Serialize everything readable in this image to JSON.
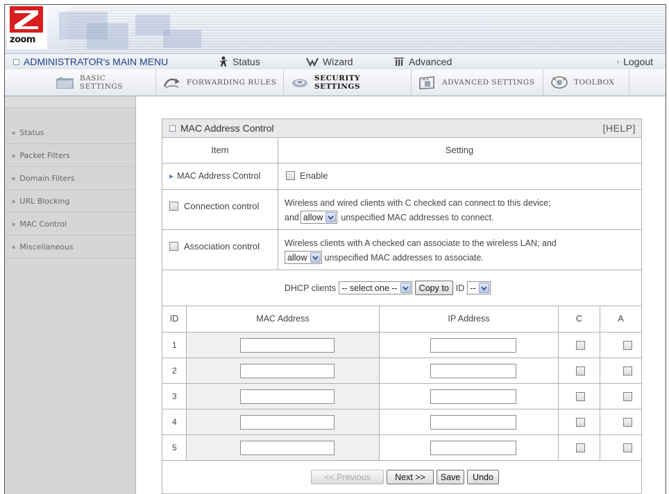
{
  "brand": {
    "logo_text": "zoom",
    "accent": "#d81e1e"
  },
  "topnav": {
    "admin": "ADMINISTRATOR's MAIN MENU",
    "status": "Status",
    "wizard": "Wizard",
    "advanced": "Advanced",
    "logout": "Logout"
  },
  "tabs": [
    {
      "label": "BASIC SETTINGS",
      "icon": "folder-icon"
    },
    {
      "label": "FORWARDING RULES",
      "icon": "arrows-icon"
    },
    {
      "label": "SECURITY SETTINGS",
      "icon": "shield-disc-icon"
    },
    {
      "label": "ADVANCED SETTINGS",
      "icon": "gear-box-icon"
    },
    {
      "label": "TOOLBOX",
      "icon": "toolbox-icon"
    }
  ],
  "sidebar": {
    "items": [
      "Status",
      "Packet Filters",
      "Domain Filters",
      "URL Blocking",
      "MAC Control",
      "Miscellaneous"
    ]
  },
  "panel": {
    "title": "MAC Address Control",
    "help": "[HELP]",
    "col_item": "Item",
    "col_setting": "Setting",
    "mac_control_label": "MAC Address Control",
    "enable_label": "Enable",
    "connection": {
      "label": "Connection control",
      "line1": "Wireless and wired clients with C checked can connect to this device;",
      "line2_pre": "and",
      "select": "allow",
      "line2_post": "unspecified MAC addresses to connect."
    },
    "association": {
      "label": "Association control",
      "line1": "Wireless clients with A checked can associate to the wireless LAN; and",
      "select": "allow",
      "line2_post": "unspecified MAC addresses to associate."
    },
    "dhcp": {
      "label": "DHCP clients",
      "select": "-- select one --",
      "copy_button": "Copy to",
      "id_label": "ID",
      "id_select": "--"
    },
    "table": {
      "headers": [
        "ID",
        "MAC Address",
        "IP Address",
        "C",
        "A"
      ],
      "rows": [
        "1",
        "2",
        "3",
        "4",
        "5"
      ]
    },
    "buttons": {
      "previous": "<< Previous",
      "next": "Next >>",
      "save": "Save",
      "undo": "Undo"
    }
  }
}
